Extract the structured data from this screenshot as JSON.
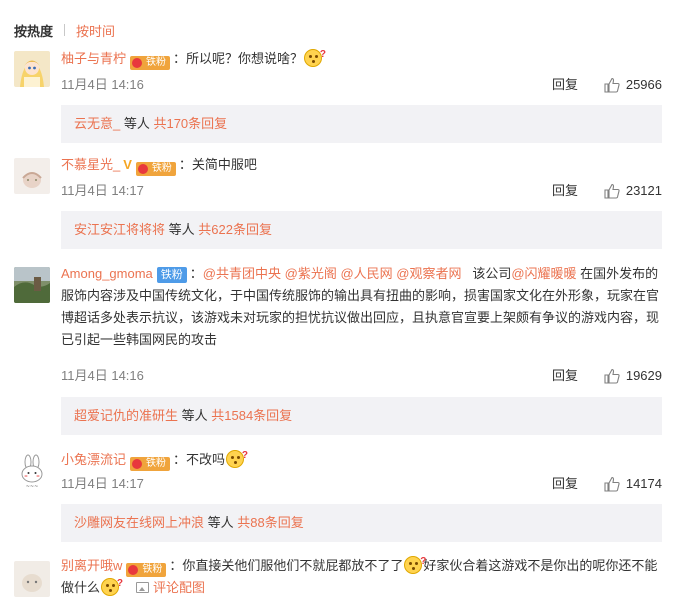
{
  "sort": {
    "active": "按热度",
    "inactive": "按时间"
  },
  "comments": [
    {
      "username": "柚子与青柠",
      "badge": "铁粉",
      "text": "：所以呢？你想说啥？",
      "time": "11月4日 14:16",
      "reply_label": "回复",
      "likes": "25966",
      "sub_name": "云无意_",
      "sub_mid": " 等人 ",
      "sub_count": "共170条回复"
    },
    {
      "username": "不慕星光_",
      "badge": "铁粉",
      "text": "：关简中服吧",
      "time": "11月4日 14:17",
      "reply_label": "回复",
      "likes": "23121",
      "sub_name": "安江安江将将将",
      "sub_mid": " 等人 ",
      "sub_count": "共622条回复"
    },
    {
      "username": "Among_gmoma",
      "badge": "铁粉",
      "mentions": [
        "@共青团中央",
        "@紫光阁",
        "@人民网",
        "@观察者网"
      ],
      "text_a": "该公司",
      "mention_b": "@闪耀暖暖",
      "text_b": "在国外发布的服饰内容涉及中国传统文化，于中国传统服饰的输出具有扭曲的影响，损害国家文化在外形象，玩家在官博超话多处表示抗议，该游戏未对玩家的担忧抗议做出回应，且执意官宣要上架颇有争议的游戏内容，现已引起一些韩国网民的攻击",
      "time": "11月4日 14:16",
      "reply_label": "回复",
      "likes": "19629",
      "sub_name": "超爱记仇的准研生",
      "sub_mid": " 等人 ",
      "sub_count": "共1584条回复"
    },
    {
      "username": "小兔漂流记",
      "badge": "铁粉",
      "text": "：不改吗",
      "time": "11月4日 14:17",
      "reply_label": "回复",
      "likes": "14174",
      "sub_name": "沙雕网友在线网上冲浪",
      "sub_mid": " 等人 ",
      "sub_count": "共88条回复"
    },
    {
      "username": "别离开哦w",
      "badge": "铁粉",
      "text_a": "：你直接关他们服他们不就屁都放不了了",
      "text_b": "好家伙合着这游戏不是你出的呢你还不能做什么",
      "pic_label": "评论配图"
    }
  ],
  "colors": {
    "accent": "#eb7350",
    "sub_bg": "#f2f2f5"
  }
}
